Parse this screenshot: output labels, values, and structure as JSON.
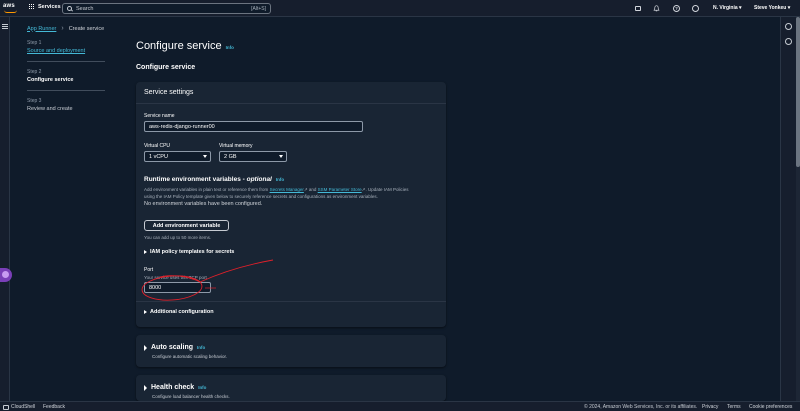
{
  "topnav": {
    "logo_text": "aws",
    "services_label": "Services",
    "search_placeholder": "Search",
    "search_shortcut": "[Alt+S]",
    "region": "N. Virginia ▾",
    "user": "Steve Yonkeu ▾"
  },
  "breadcrumb": {
    "parent": "App Runner",
    "current": "Create service"
  },
  "steps": [
    {
      "num": "Step 1",
      "title": "Source and deployment"
    },
    {
      "num": "Step 2",
      "title": "Configure service"
    },
    {
      "num": "Step 3",
      "title": "Review and create"
    }
  ],
  "page": {
    "title": "Configure service",
    "info": "Info",
    "subtitle": "Configure service"
  },
  "service_settings": {
    "header": "Service settings",
    "name_label": "Service name",
    "name_value": "aws-redis-django-runner00",
    "cpu_label": "Virtual CPU",
    "cpu_value": "1 vCPU",
    "memory_label": "Virtual memory",
    "memory_value": "2 GB",
    "env_title": "Runtime environment variables - ",
    "env_optional": "optional",
    "env_info": "Info",
    "env_desc_1": "Add environment variables in plain text or reference them from ",
    "env_link_1": "Secrets Manager",
    "env_desc_and": " and ",
    "env_link_2": "SSM Parameter Store",
    "env_desc_2": ". Update IAM Policies",
    "env_desc_3": "using the IAM Policy template given below to securely reference secrets and configurations as environment variables.",
    "no_env": "No environment variables have been configured.",
    "add_env_button": "Add environment variable",
    "add_hint": "You can add up to 50 more items.",
    "iam_templates": "IAM policy templates for secrets",
    "port_label": "Port",
    "port_desc": "Your service uses this TCP port.",
    "port_value": "8000",
    "additional": "Additional configuration"
  },
  "auto_scaling": {
    "title": "Auto scaling",
    "info": "Info",
    "desc": "Configure automatic scaling behavior."
  },
  "health_check": {
    "title": "Health check",
    "info": "Info",
    "desc": "Configure load balancer health checks."
  },
  "footer": {
    "cloudshell": "CloudShell",
    "feedback": "Feedback",
    "copyright": "© 2024, Amazon Web Services, Inc. or its affiliates.",
    "privacy": "Privacy",
    "terms": "Terms",
    "cookies": "Cookie preferences"
  },
  "colors": {
    "background": "#0f1b2a",
    "link": "#44b9d6",
    "annotation": "#e0202a",
    "aws_orange": "#ff9900"
  },
  "icons": [
    "aws-logo",
    "grid-icon",
    "search-icon",
    "cloudshell-icon",
    "bell-icon",
    "help-icon",
    "gear-icon",
    "menu-icon",
    "info-circle-icon",
    "clock-icon",
    "external-link-icon",
    "caret-right-icon",
    "caret-down-icon"
  ]
}
